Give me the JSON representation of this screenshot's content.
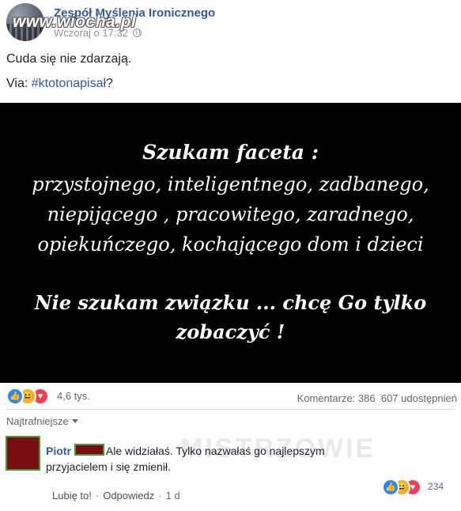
{
  "post": {
    "watermark": "www.wiocha.pl",
    "page_name": "Zespół Myślenia Ironicznego",
    "timestamp": "Wczoraj o 17:32",
    "text": "Cuda się nie zdarzają.",
    "via_prefix": "Via: ",
    "via_hashtag": "#ktotonapisał",
    "via_suffix": "?"
  },
  "image_text": {
    "line1": "Szukam faceta :",
    "line2": "przystojnego, inteligentnego, zadbanego,",
    "line3": "niepijącego , pracowitego, zaradnego,",
    "line4": "opiekuńczego, kochającego dom i dzieci",
    "line5": "Nie szukam związku ... chcę Go tylko",
    "line6": "zobaczyć  !"
  },
  "reactions": {
    "icons": [
      "like-icon",
      "haha-icon",
      "love-icon"
    ],
    "count": "4,6 tys.",
    "comments": "Komentarze: 386",
    "shares": "607 udostępnień"
  },
  "comments_section": {
    "sort_label": "Najtrafniejsze",
    "watermark": "MISTRZOWIE",
    "comment": {
      "author": "Piotr",
      "text": "Ale widziałaś. Tylko nazwałaś go najlepszym przyjacielem i się zmienił.",
      "reaction_count": "234",
      "like_action": "Lubię to!",
      "reply_action": "Odpowiedz",
      "age": "1 d"
    }
  },
  "colors": {
    "link": "#365899",
    "meta": "#90949c",
    "like": "#2d88ff",
    "haha": "#f7b125",
    "love": "#f33e58"
  }
}
